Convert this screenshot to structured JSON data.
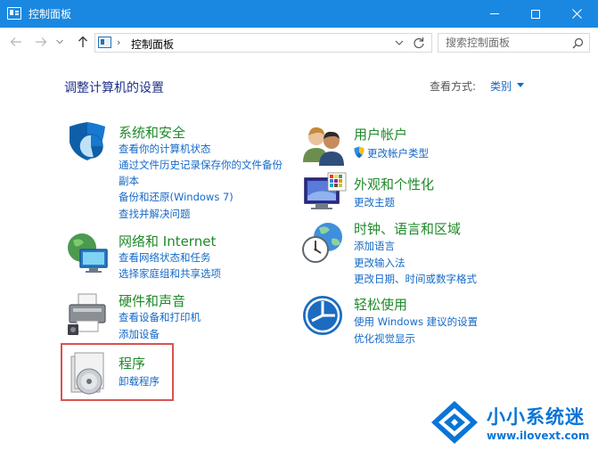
{
  "window": {
    "title": "控制面板"
  },
  "address": {
    "path": "控制面板"
  },
  "search": {
    "placeholder": "搜索控制面板"
  },
  "content": {
    "heading": "调整计算机的设置",
    "view_by_label": "查看方式:",
    "view_by_value": "类别"
  },
  "categories": {
    "system": {
      "title": "系统和安全",
      "links": [
        "查看你的计算机状态",
        "通过文件历史记录保存你的文件备份",
        "副本",
        "备份和还原(Windows 7)",
        "查找并解决问题"
      ]
    },
    "network": {
      "title": "网络和 Internet",
      "links": [
        "查看网络状态和任务",
        "选择家庭组和共享选项"
      ]
    },
    "hardware": {
      "title": "硬件和声音",
      "links": [
        "查看设备和打印机",
        "添加设备"
      ]
    },
    "programs": {
      "title": "程序",
      "links": [
        "卸载程序"
      ]
    },
    "users": {
      "title": "用户帐户",
      "links": [
        "更改帐户类型"
      ]
    },
    "appearance": {
      "title": "外观和个性化",
      "links": [
        "更改主题"
      ]
    },
    "clock": {
      "title": "时钟、语言和区域",
      "links": [
        "添加语言",
        "更改输入法",
        "更改日期、时间或数字格式"
      ]
    },
    "ease": {
      "title": "轻松使用",
      "links": [
        "使用 Windows 建议的设置",
        "优化视觉显示"
      ]
    }
  },
  "watermark": {
    "name": "小小系统迷",
    "url": "www.ilovext.com"
  },
  "colors": {
    "titlebar": "#1a88e0",
    "category_title": "#1f8a2a",
    "link": "#1569c7",
    "heading": "#1e3287",
    "highlight": "#d9534f"
  }
}
